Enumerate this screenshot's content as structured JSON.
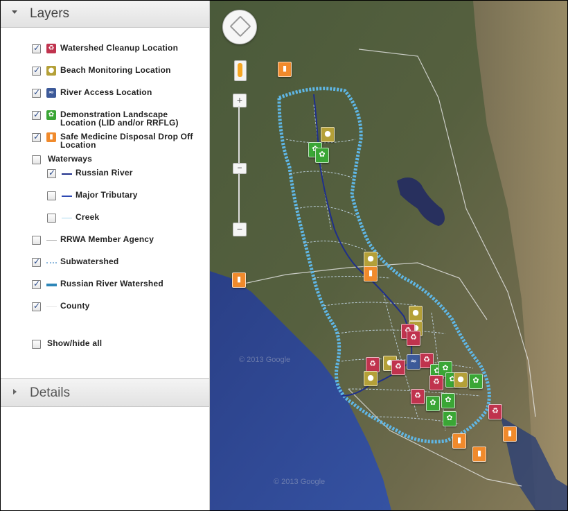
{
  "layers_panel": {
    "title": "Layers"
  },
  "details_panel": {
    "title": "Details"
  },
  "layers": [
    {
      "id": "watershed-cleanup",
      "label": "Watershed Cleanup Location",
      "checked": true,
      "icon": "cleanup-icon",
      "color": "#c0334e"
    },
    {
      "id": "beach-monitoring",
      "label": "Beach Monitoring Location",
      "checked": true,
      "icon": "water-drop-icon",
      "color": "#b4a038"
    },
    {
      "id": "river-access",
      "label": "River Access Location",
      "checked": true,
      "icon": "river-access-icon",
      "color": "#3d5a99"
    },
    {
      "id": "demo-landscape",
      "label": "Demonstration Landscape",
      "label2": "Location (LID and/or RRFLG)",
      "checked": true,
      "icon": "plant-icon",
      "color": "#3aa635"
    },
    {
      "id": "safe-medicine",
      "label": "Safe Medicine Disposal Drop Off",
      "label2": "Location",
      "checked": true,
      "icon": "medicine-bottle-icon",
      "color": "#f08a2c"
    },
    {
      "id": "waterways",
      "label": "Waterways",
      "checked": false
    },
    {
      "id": "russian-river",
      "label": "Russian River",
      "checked": true,
      "line_color": "#1f2f8a"
    },
    {
      "id": "major-tributary",
      "label": "Major Tributary",
      "checked": false,
      "line_color": "#2e49b3"
    },
    {
      "id": "creek",
      "label": "Creek",
      "checked": false,
      "line_color": "#a8d8ee"
    },
    {
      "id": "rrwa-member-agency",
      "label": "RRWA Member Agency",
      "checked": false,
      "line_color": "#aaaaaa"
    },
    {
      "id": "subwatershed",
      "label": "Subwatershed",
      "checked": true,
      "line_color": "#8fb9dd"
    },
    {
      "id": "russian-river-watershed",
      "label": "Russian River Watershed",
      "checked": true,
      "line_color": "#2d86b8"
    },
    {
      "id": "county",
      "label": "County",
      "checked": true,
      "line_color": "#e4e4e4"
    }
  ],
  "show_hide_all": {
    "label": "Show/hide all",
    "checked": false
  },
  "map": {
    "watermark_1": "© 2013 Google",
    "watermark_2": "© 2013 Google"
  }
}
